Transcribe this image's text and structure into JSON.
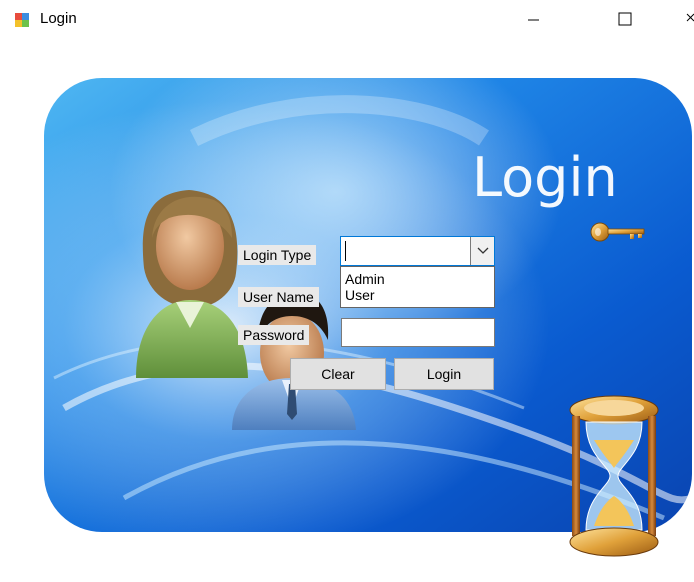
{
  "window": {
    "title": "Login",
    "icon": "windows-forms-icon",
    "controls": [
      "minimize-icon",
      "maximize-icon",
      "close-icon"
    ]
  },
  "hero": {
    "heading": "Login",
    "illustrations": [
      "users-icon",
      "key-icon",
      "hourglass-icon"
    ]
  },
  "form": {
    "login_type_label": "Login Type",
    "login_type_value": "",
    "login_type_options": [
      "Admin",
      "User"
    ],
    "username_label": "User Name",
    "password_label": "Password",
    "password_value": "",
    "clear_label": "Clear",
    "login_label": "Login"
  },
  "colors": {
    "panel_blue": "#0d5fcf",
    "panel_light": "#9fd7ff",
    "focus_border": "#0078d7",
    "button_bg": "#e1e1e1"
  }
}
